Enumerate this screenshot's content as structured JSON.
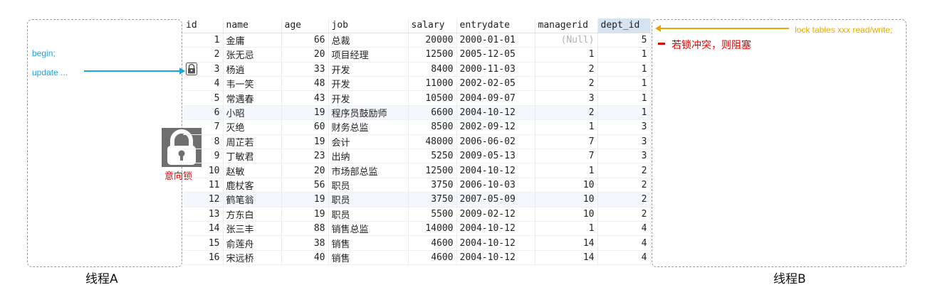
{
  "thread_a": {
    "label": "线程A",
    "line1": "begin;",
    "line2": "update ..."
  },
  "thread_b": {
    "label": "线程B",
    "lock_stmt": "lock tables xxx read/write;",
    "blocked_note": "若锁冲突，则阻塞"
  },
  "intent_lock_label": "意向锁",
  "colors": {
    "blue": "#1ba4e0",
    "orange": "#e8a800",
    "red": "#e00000",
    "lock_gray": "#6f6f6f"
  },
  "table": {
    "columns": [
      "id",
      "name",
      "age",
      "job",
      "salary",
      "entrydate",
      "managerid",
      "dept_id"
    ],
    "rows": [
      [
        "1",
        "金庸",
        "66",
        "总裁",
        "20000",
        "2000-01-01",
        "(Null)",
        "5"
      ],
      [
        "2",
        "张无忌",
        "20",
        "项目经理",
        "12500",
        "2005-12-05",
        "1",
        "1"
      ],
      [
        "3",
        "杨逍",
        "33",
        "开发",
        "8400",
        "2000-11-03",
        "2",
        "1"
      ],
      [
        "4",
        "韦一笑",
        "48",
        "开发",
        "11000",
        "2002-02-05",
        "2",
        "1"
      ],
      [
        "5",
        "常遇春",
        "43",
        "开发",
        "10500",
        "2004-09-07",
        "3",
        "1"
      ],
      [
        "6",
        "小昭",
        "19",
        "程序员鼓励师",
        "6600",
        "2004-10-12",
        "2",
        "1"
      ],
      [
        "7",
        "灭绝",
        "60",
        "财务总监",
        "8500",
        "2002-09-12",
        "1",
        "3"
      ],
      [
        "8",
        "周芷若",
        "19",
        "会计",
        "48000",
        "2006-06-02",
        "7",
        "3"
      ],
      [
        "9",
        "丁敏君",
        "23",
        "出纳",
        "5250",
        "2009-05-13",
        "7",
        "3"
      ],
      [
        "10",
        "赵敏",
        "20",
        "市场部总监",
        "12500",
        "2004-10-12",
        "1",
        "2"
      ],
      [
        "11",
        "鹿杖客",
        "56",
        "职员",
        "3750",
        "2006-10-03",
        "10",
        "2"
      ],
      [
        "12",
        "鹤笔翁",
        "19",
        "职员",
        "3750",
        "2007-05-09",
        "10",
        "2"
      ],
      [
        "13",
        "方东白",
        "19",
        "职员",
        "5500",
        "2009-02-12",
        "10",
        "2"
      ],
      [
        "14",
        "张三丰",
        "88",
        "销售总监",
        "14000",
        "2004-10-12",
        "1",
        "4"
      ],
      [
        "15",
        "俞莲舟",
        "38",
        "销售",
        "4600",
        "2004-10-12",
        "14",
        "4"
      ],
      [
        "16",
        "宋远桥",
        "40",
        "销售",
        "4600",
        "2004-10-12",
        "14",
        "4"
      ]
    ]
  }
}
